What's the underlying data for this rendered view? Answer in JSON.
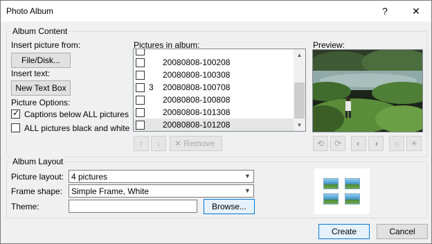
{
  "window": {
    "title": "Photo Album",
    "help_glyph": "?",
    "close_glyph": "✕"
  },
  "album_content": {
    "group_label": "Album Content",
    "insert_picture_label": "Insert picture from:",
    "file_disk_button": "File/Disk...",
    "insert_text_label": "Insert text:",
    "new_text_box_button": "New Text Box",
    "picture_options_label": "Picture Options:",
    "captions_below_all": {
      "label": "Captions below ALL pictures",
      "checked": true
    },
    "all_black_white": {
      "label": "ALL pictures black and white",
      "checked": false
    },
    "pictures_in_album_label": "Pictures in album:",
    "pictures": [
      {
        "num": "",
        "name": "20080808-100208"
      },
      {
        "num": "",
        "name": "20080808-100308"
      },
      {
        "num": "3",
        "name": "20080808-100708"
      },
      {
        "num": "",
        "name": "20080808-100808"
      },
      {
        "num": "",
        "name": "20080808-101308"
      },
      {
        "num": "",
        "name": "20080808-101208"
      }
    ],
    "remove_button": "Remove",
    "preview_label": "Preview:"
  },
  "album_layout": {
    "group_label": "Album Layout",
    "picture_layout_label": "Picture layout:",
    "picture_layout_value": "4 pictures",
    "frame_shape_label": "Frame shape:",
    "frame_shape_value": "Simple Frame, White",
    "theme_label": "Theme:",
    "theme_value": "",
    "browse_button": "Browse..."
  },
  "footer": {
    "create_button": "Create",
    "cancel_button": "Cancel"
  },
  "colors": {
    "selection": "#e5e5e5",
    "focus_border": "#0078d7"
  },
  "icons": {
    "move_up": "arrow-up-icon",
    "move_down": "arrow-down-icon",
    "remove": "remove-x-icon",
    "rotate_left": "rotate-left-icon",
    "rotate_right": "rotate-right-icon",
    "contrast_up": "contrast-up-icon",
    "contrast_down": "contrast-down-icon",
    "brightness_up": "brightness-up-icon",
    "brightness_down": "brightness-down-icon"
  }
}
